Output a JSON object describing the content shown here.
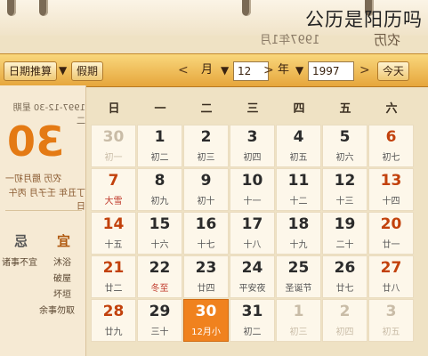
{
  "caption": "公历是阳历吗",
  "header": {
    "title_a": "1997年1月",
    "title_b": "农历"
  },
  "toolbar": {
    "today_label": "今天",
    "year_value": "1997",
    "year_label": "年",
    "month_value": "12",
    "month_label": "月",
    "holiday_label": "假期",
    "query_label": "日期推算",
    "prev_label": "<",
    "next_label": ">"
  },
  "sidebar": {
    "date_line": "1997-12-30 星期二",
    "big_day": "30",
    "lunar_line": "农历 腊月初一",
    "ganzhi_line": "丁丑年 壬子月 丙午日",
    "yi_label": "宜",
    "ji_label": "忌",
    "yi_items": [
      "沐浴",
      "破屋",
      "坏垣",
      "余事勿取"
    ],
    "ji_items": [
      "诸事不宜"
    ]
  },
  "weekdays": [
    "日",
    "一",
    "二",
    "三",
    "四",
    "五",
    "六"
  ],
  "rows": [
    [
      {
        "d": "30",
        "l": "初一",
        "t": "other"
      },
      {
        "d": "1",
        "l": "初二"
      },
      {
        "d": "2",
        "l": "初三"
      },
      {
        "d": "3",
        "l": "初四"
      },
      {
        "d": "4",
        "l": "初五"
      },
      {
        "d": "5",
        "l": "初六"
      },
      {
        "d": "6",
        "l": "初七"
      }
    ],
    [
      {
        "d": "7",
        "l": "大雪",
        "t": "festival"
      },
      {
        "d": "8",
        "l": "初九"
      },
      {
        "d": "9",
        "l": "初十"
      },
      {
        "d": "10",
        "l": "十一"
      },
      {
        "d": "11",
        "l": "十二"
      },
      {
        "d": "12",
        "l": "十三"
      },
      {
        "d": "13",
        "l": "十四"
      }
    ],
    [
      {
        "d": "14",
        "l": "十五"
      },
      {
        "d": "15",
        "l": "十六"
      },
      {
        "d": "16",
        "l": "十七"
      },
      {
        "d": "17",
        "l": "十八"
      },
      {
        "d": "18",
        "l": "十九"
      },
      {
        "d": "19",
        "l": "二十"
      },
      {
        "d": "20",
        "l": "廿一"
      }
    ],
    [
      {
        "d": "21",
        "l": "廿二"
      },
      {
        "d": "22",
        "l": "冬至",
        "t": "festival"
      },
      {
        "d": "23",
        "l": "廿四"
      },
      {
        "d": "24",
        "l": "平安夜"
      },
      {
        "d": "25",
        "l": "圣诞节"
      },
      {
        "d": "26",
        "l": "廿七"
      },
      {
        "d": "27",
        "l": "廿八"
      }
    ],
    [
      {
        "d": "28",
        "l": "廿九"
      },
      {
        "d": "29",
        "l": "三十"
      },
      {
        "d": "30",
        "l": "12月小",
        "t": "today"
      },
      {
        "d": "31",
        "l": "初二"
      },
      {
        "d": "1",
        "l": "初三",
        "t": "other"
      },
      {
        "d": "2",
        "l": "初四",
        "t": "other"
      },
      {
        "d": "3",
        "l": "初五",
        "t": "other"
      }
    ]
  ],
  "colors": {
    "accent": "#f0821e",
    "toolbar": "#e6a63c",
    "weekend": "#c2410c"
  }
}
